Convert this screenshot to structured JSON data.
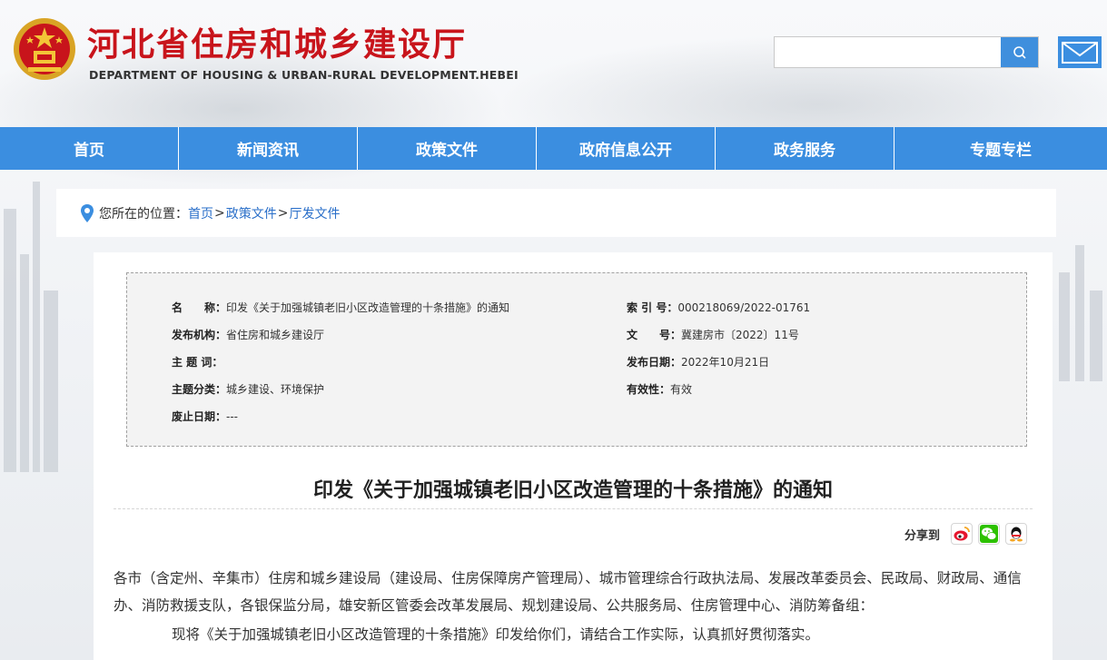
{
  "header": {
    "title": "河北省住房和城乡建设厅",
    "subtitle": "DEPARTMENT OF HOUSING & URBAN-RURAL DEVELOPMENT.HEBEI",
    "search_placeholder": ""
  },
  "icons": {
    "search": "search-icon",
    "mail": "mail-icon",
    "location": "location-pin-icon",
    "weibo": "weibo-icon",
    "wechat": "wechat-icon",
    "qq": "qq-icon",
    "emblem": "national-emblem-icon"
  },
  "colors": {
    "brand_red": "#c8141b",
    "nav_blue": "#3b8ee0",
    "link_blue": "#2a6fc9"
  },
  "nav": {
    "items": [
      "首页",
      "新闻资讯",
      "政策文件",
      "政府信息公开",
      "政务服务",
      "专题专栏"
    ]
  },
  "breadcrumb": {
    "label": "您所在的位置：",
    "items": [
      "首页",
      "政策文件",
      "厅发文件"
    ],
    "separator": ">"
  },
  "meta": {
    "name_key": "名　　称：",
    "name_val": "印发《关于加强城镇老旧小区改造管理的十条措施》的通知",
    "index_key": "索 引 号：",
    "index_val": "000218069/2022-01761",
    "publisher_key": "发布机构：",
    "publisher_val": "省住房和城乡建设厅",
    "docno_key": "文　　号：",
    "docno_val": "冀建房市〔2022〕11号",
    "keywords_key": "主 题 词：",
    "keywords_val": "",
    "date_key": "发布日期：",
    "date_val": "2022年10月21日",
    "category_key": "主题分类：",
    "category_val": "城乡建设、环境保护",
    "validity_key": "有效性：",
    "validity_val": "有效",
    "expiry_key": "废止日期：",
    "expiry_val": "---"
  },
  "article": {
    "title": "印发《关于加强城镇老旧小区改造管理的十条措施》的通知",
    "share_label": "分享到",
    "para1": "各市（含定州、辛集市）住房和城乡建设局（建设局、住房保障房产管理局）、城市管理综合行政执法局、发展改革委员会、民政局、财政局、通信办、消防救援支队，各银保监分局，雄安新区管委会改革发展局、规划建设局、公共服务局、住房管理中心、消防筹备组：",
    "para2": "现将《关于加强城镇老旧小区改造管理的十条措施》印发给你们，请结合工作实际，认真抓好贯彻落实。"
  }
}
